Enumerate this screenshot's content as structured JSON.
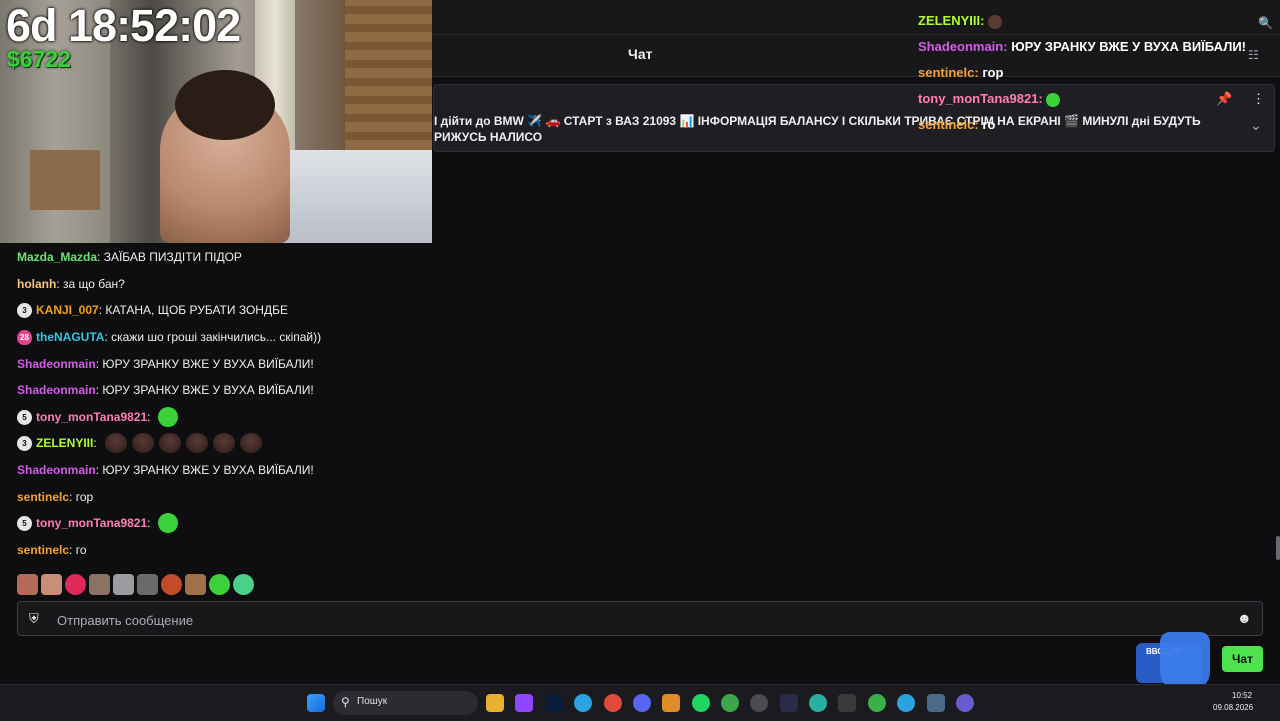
{
  "header": {
    "title": "Чат"
  },
  "pinned": {
    "text": "І дійти до BMW ✈️ 🚗 СТАРТ з ВАЗ 21093 📊 ІНФОРМАЦІЯ БАЛАНСУ І СКІЛЬКИ ТРИВАЄ СТРІМ НА ЕКРАНІ 🎬 МИНУЛІ дні БУДУТЬ РИЖУСЬ НАЛИСО"
  },
  "overlay": {
    "timer": "6d 18:52:02",
    "money": "$6722",
    "lines": [
      {
        "user": "ZELENYIII:",
        "text": "",
        "color": "#adff2f"
      },
      {
        "user": "Shadeonmain:",
        "text": "ЮРУ ЗРАНКУ ВЖЕ У ВУХА ВИЇБАЛИ!",
        "color": "#d25ee5"
      },
      {
        "user": "sentinelc:",
        "text": "гор",
        "color": "#f2a33a"
      },
      {
        "user": "tony_monTana9821:",
        "text": "",
        "color": "#ff7fb0"
      },
      {
        "user": "sentinelc:",
        "text": "го",
        "color": "#f2a33a"
      }
    ]
  },
  "messages": [
    {
      "badge": "",
      "user": "Mazda_Mazda",
      "text": "ЗАЇБАВ ПИЗДІТИ ПІДОР",
      "color": "#6ee26e"
    },
    {
      "badge": "",
      "user": "holanh",
      "text": "за що бан?",
      "color": "#f5c77e"
    },
    {
      "badge": "3",
      "user": "KANJI_007",
      "text": "КАТАНА, ЩОБ РУБАТИ ЗОНДБЕ",
      "color": "#f0a020"
    },
    {
      "badge": "28",
      "user": "theNAGUTA",
      "text": "скажи шо гроші закінчились... скіпай))",
      "color": "#34c6e0"
    },
    {
      "badge": "",
      "user": "Shadeonmain",
      "text": "ЮРУ ЗРАНКУ ВЖЕ У ВУХА ВИЇБАЛИ!",
      "color": "#d25ee5"
    },
    {
      "badge": "",
      "user": "Shadeonmain",
      "text": "ЮРУ ЗРАНКУ ВЖЕ У ВУХА ВИЇБАЛИ!",
      "color": "#d25ee5"
    },
    {
      "badge": "5",
      "user": "tony_monTana9821",
      "text": "",
      "color": "#ff7fb0"
    },
    {
      "badge": "3",
      "user": "ZELENYIII",
      "text": "",
      "color": "#adff2f"
    },
    {
      "badge": "",
      "user": "Shadeonmain",
      "text": "ЮРУ ЗРАНКУ ВЖЕ У ВУХА ВИЇБАЛИ!",
      "color": "#d25ee5"
    },
    {
      "badge": "",
      "user": "sentinelc",
      "text": "гор",
      "color": "#f2a33a"
    },
    {
      "badge": "5",
      "user": "tony_monTana9821",
      "text": "",
      "color": "#ff7fb0"
    },
    {
      "badge": "",
      "user": "sentinelc",
      "text": "го",
      "color": "#f2a33a"
    }
  ],
  "input": {
    "placeholder": "Отправить сообщение"
  },
  "chat_button": "Чат",
  "widget_label": "ВВОД ПР",
  "taskbar": {
    "search_label": "Пошук",
    "time": "10:52",
    "date": "09.08.2026"
  }
}
